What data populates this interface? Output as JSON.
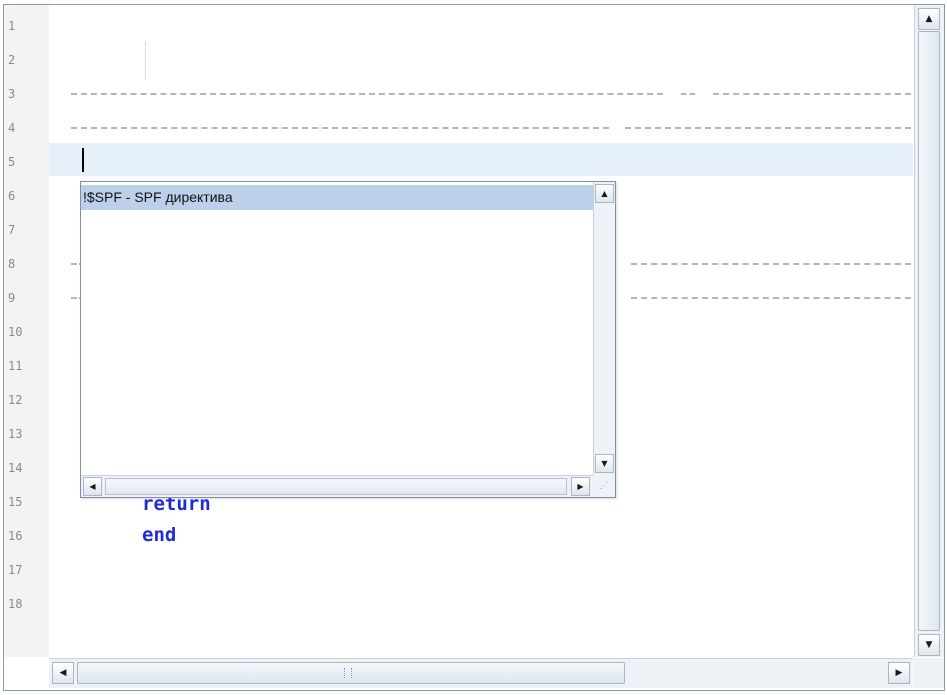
{
  "editor": {
    "line_numbers": [
      "1",
      "2",
      "3",
      "4",
      "5",
      "6",
      "7",
      "8",
      "9",
      "10",
      "11",
      "12",
      "13",
      "14",
      "15",
      "16",
      "17",
      "18"
    ],
    "current_line_text": "!$",
    "comment_marker": "!",
    "keywords": {
      "line15": "return",
      "line16": "end"
    },
    "colors": {
      "keyword": "#1f2bd6",
      "current_line": "#e5f0fb",
      "popup_selection": "#bcd0ea"
    }
  },
  "autocomplete": {
    "items": [
      {
        "label": "!$SPF  - SPF директива",
        "selected": true
      }
    ]
  },
  "icons": {
    "scroll_up": "▲",
    "scroll_down": "▼",
    "scroll_left": "◀",
    "scroll_right": "▶"
  }
}
